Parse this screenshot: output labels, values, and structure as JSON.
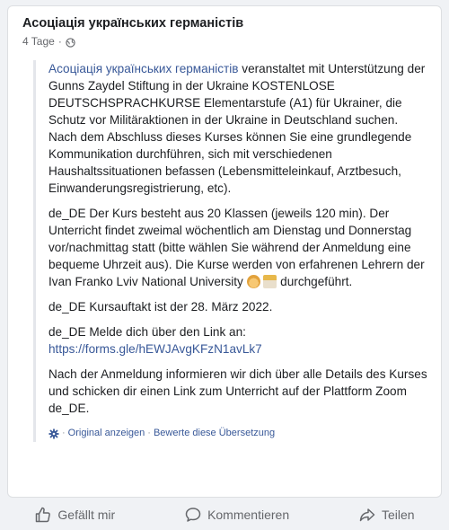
{
  "post": {
    "author": "Асоціація українських германістів",
    "time": "4 Tage",
    "dot": "·",
    "paragraphs": [
      {
        "link": "Асоціація українських германістів",
        "text": " veranstaltet mit Unterstützung der Gunns Zaydel Stiftung in der Ukraine KOSTENLOSE DEUTSCHSPRACHKURSE Elementarstufe (A1) für Ukrainer, die Schutz vor Militäraktionen in der Ukraine in Deutschland suchen. Nach dem Abschluss dieses Kurses können Sie eine grundlegende Kommunikation durchführen, sich mit verschiedenen Haushaltssituationen befassen (Lebensmitteleinkauf, Arztbesuch, Einwanderungsregistrierung, etc)."
      },
      {
        "text": "de_DE Der Kurs besteht aus 20 Klassen (jeweils 120 min). Der Unterricht findet zweimal wöchentlich am Dienstag und Donnerstag vor/nachmittag statt (bitte wählen Sie während der Anmeldung eine bequeme Uhrzeit aus). Die Kurse werden von erfahrenen Lehrern der Ivan Franko Lviv National University",
        "after_emoji": " durchgeführt."
      },
      {
        "text": "de_DE Kursauftakt ist der 28. März 2022."
      },
      {
        "text": "de_DE Melde dich über den Link an:",
        "link": "https://forms.gle/hEWJAvgKFzN1avLk7"
      },
      {
        "text": "Nach der Anmeldung informieren wir dich über alle Details des Kurses und schicken dir einen Link zum Unterricht auf der Plattform Zoom de_DE."
      }
    ],
    "translation": {
      "dot1": "·",
      "show_original": "Original anzeigen",
      "dot2": "·",
      "rate": "Bewerte diese Übersetzung"
    }
  },
  "actions": {
    "like": "Gefällt mir",
    "comment": "Kommentieren",
    "share": "Teilen"
  },
  "colors": {
    "link": "#385898",
    "muted": "#65676b",
    "background": "#f0f2f5"
  }
}
